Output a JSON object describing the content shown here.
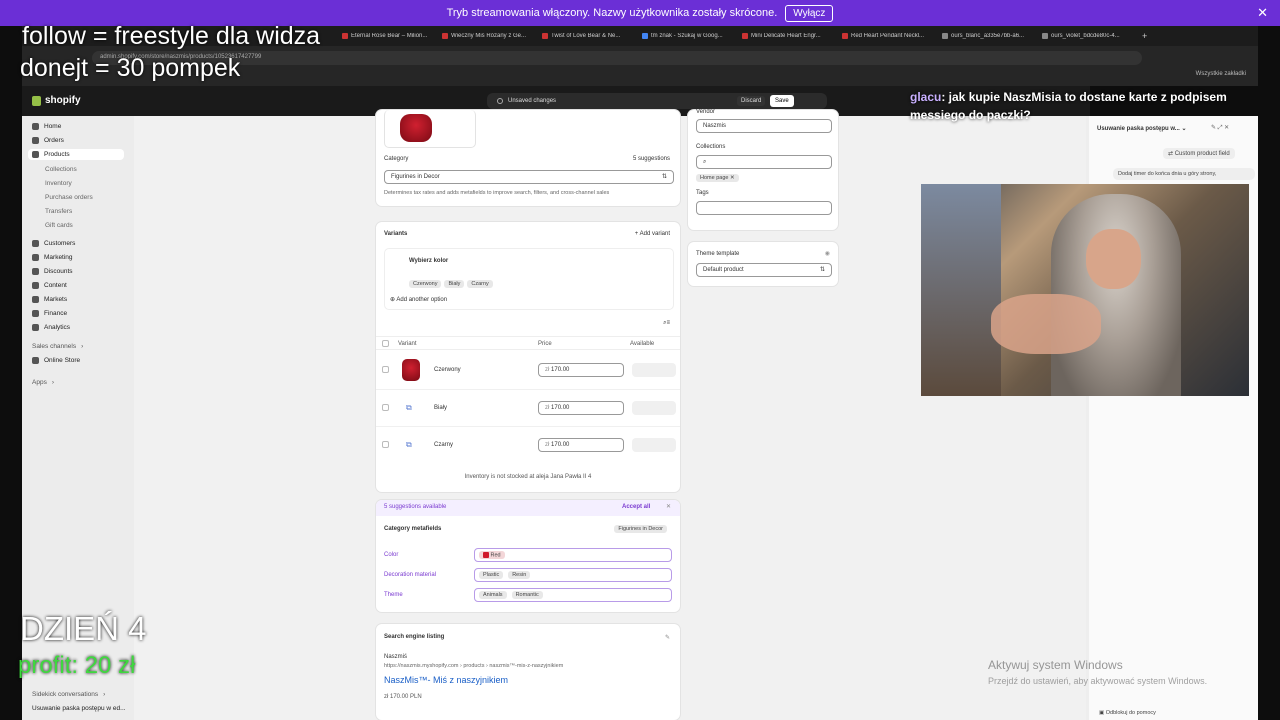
{
  "banner": {
    "text": "Tryb streamowania włączony. Nazwy użytkownika zostały skrócone.",
    "button": "Wyłącz"
  },
  "browser_tabs": [
    "Eternal Rose Bear – Milion...",
    "Wieczny Miś Różany z Ge...",
    "Twist of Love Bear & Ne...",
    "tm znak - Szukaj w Goog...",
    "Mini Delicate Heart Engr...",
    "Red Heart Pendant Neckl...",
    "ours_blanc_a335e7bb-a6...",
    "ours_violet_bdcde80c-4..."
  ],
  "address": "admin.shopify.com/store/naszmis/products/10523617427799",
  "bookmarks_label": "Wszystkie zakładki",
  "shopify": {
    "logo": "shopify",
    "unsaved": "Unsaved changes",
    "discard": "Discard",
    "save": "Save"
  },
  "sidebar": {
    "items": [
      "Home",
      "Orders",
      "Products",
      "Collections",
      "Inventory",
      "Purchase orders",
      "Transfers",
      "Gift cards",
      "Customers",
      "Marketing",
      "Discounts",
      "Content",
      "Markets",
      "Finance",
      "Analytics"
    ],
    "sales_channels": "Sales channels",
    "online_store": "Online Store",
    "apps": "Apps",
    "sidekick": "Sidekick conversations",
    "sidekick_item": "Usuwanie paska postępu w ed..."
  },
  "category": {
    "label": "Category",
    "suggestions": "5 suggestions",
    "value": "Figurines in Decor",
    "help": "Determines tax rates and adds metafields to improve search, filters, and cross-channel sales"
  },
  "variants": {
    "title": "Variants",
    "add": "Add variant",
    "option_name": "Wybierz kolor",
    "option_values": [
      "Czerwony",
      "Biały",
      "Czarny"
    ],
    "add_option": "Add another option",
    "col_variant": "Variant",
    "col_price": "Price",
    "col_available": "Available",
    "rows": [
      {
        "name": "Czerwony",
        "currency": "zł",
        "price": "170.00"
      },
      {
        "name": "Biały",
        "currency": "zł",
        "price": "170.00"
      },
      {
        "name": "Czarny",
        "currency": "zł",
        "price": "170.00"
      }
    ],
    "inventory_note": "Inventory is not stocked at aleja Jana Pawła II 4"
  },
  "metafields": {
    "suggestions": "5 suggestions available",
    "accept_all": "Accept all",
    "title": "Category metafields",
    "category_tag": "Figurines in Decor",
    "color_label": "Color",
    "color_value": "Red",
    "decoration_label": "Decoration material",
    "decoration_values": [
      "Plastic",
      "Resin"
    ],
    "theme_label": "Theme",
    "theme_values": [
      "Animals",
      "Romantic"
    ]
  },
  "seo": {
    "title": "Search engine listing",
    "store": "Naszmiś",
    "url": "https://naszmis.myshopify.com › products › naszmis™-mis-z-naszyjnikiem",
    "page_title": "NaszMis™- Miś z naszyjnikiem",
    "price": "zł 170.00 PLN"
  },
  "organization": {
    "vendor_label": "Vendor",
    "vendor": "Naszmis",
    "collections_label": "Collections",
    "collection_tag": "Home page",
    "tags_label": "Tags",
    "theme_template_label": "Theme template",
    "theme_template": "Default product"
  },
  "sidekick_panel": {
    "title": "Usuwanie paska postępu w...",
    "chip": "Custom product field",
    "message": "Dodaj timer do końca dnia u góry strony,",
    "help_button": "Odblokuj do pomocy"
  },
  "overlay": {
    "line1": "follow = freestyle dla widza",
    "line2": "donejt = 30 pompek",
    "day": "DZIEŃ 4",
    "profit": "profit: 20 zł"
  },
  "chat": {
    "user": "glacu",
    "message": ": jak kupie NaszMisia to dostane karte z podpisem messiego do paczki?"
  },
  "windows_activate": {
    "title": "Aktywuj system Windows",
    "sub": "Przejdź do ustawień, aby aktywować system Windows."
  },
  "colors": {
    "banner": "#6b2fd6",
    "accent_purple": "#7b3bd1",
    "profit_green": "#3fd83f"
  }
}
